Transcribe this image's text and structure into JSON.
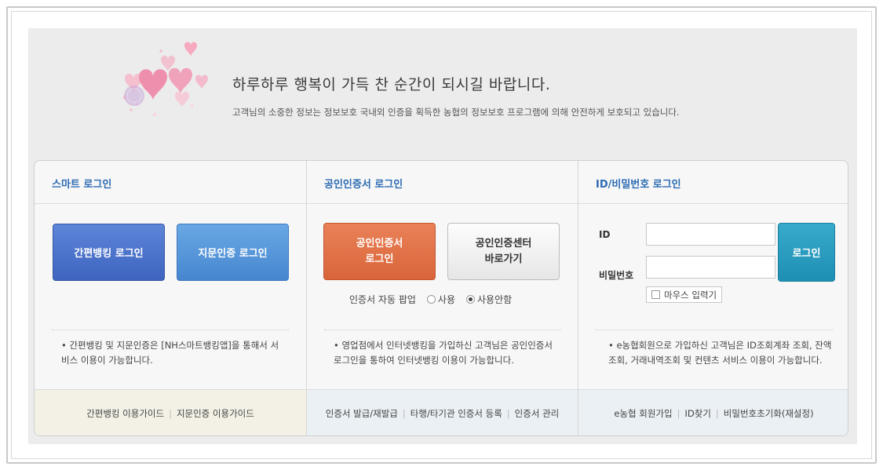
{
  "header": {
    "headline": "하루하루 행복이 가득 찬 순간이 되시길 바랍니다.",
    "subline": "고객님의 소중한 정보는 정보보호 국내외 인증을 획득한 농협의 정보보호 프로그램에 의해 안전하게 보호되고 있습니다."
  },
  "smart": {
    "title": "스마트 로그인",
    "simple_button": "간편뱅킹 로그인",
    "finger_button": "지문인증 로그인",
    "note": "• 간편뱅킹 및 지문인증은 [NH스마트뱅킹앱]을 통해서 서비스 이용이 가능합니다.",
    "footer_link1": "간편뱅킹 이용가이드",
    "footer_link2": "지문인증 이용가이드"
  },
  "cert": {
    "title": "공인인증서 로그인",
    "login_button_line1": "공인인증서",
    "login_button_line2": "로그인",
    "center_button_line1": "공인인증센터",
    "center_button_line2": "바로가기",
    "popup_label": "인증서 자동 팝업",
    "radio_use": "사용",
    "radio_nouse": "사용안함",
    "note": "• 영업점에서 인터넷뱅킹을 가입하신 고객님은 공인인증서 로그인을 통하여 인터넷뱅킹 이용이 가능합니다.",
    "footer_link1": "인증서 발급/재발급",
    "footer_link2": "타행/타기관 인증서 등록",
    "footer_link3": "인증서 관리"
  },
  "idlogin": {
    "title": "ID/비밀번호 로그인",
    "id_label": "ID",
    "pw_label": "비밀번호",
    "login_button": "로그인",
    "mouse_input": "마우스 입력기",
    "note": "• e농협회원으로 가입하신 고객님은 ID조회계좌 조회, 잔액조회, 거래내역조회 및 컨텐츠 서비스 이용이 가능합니다.",
    "footer_link1": "e농협 회원가입",
    "footer_link2": "ID찾기",
    "footer_link3": "비밀번호초기화(재설정)"
  },
  "colors": {
    "title_blue": "#2c6bb3",
    "simple_blue": "#4a70c9",
    "finger_blue": "#5497da",
    "cert_orange": "#e0703f",
    "login_teal": "#2a9dc0"
  }
}
